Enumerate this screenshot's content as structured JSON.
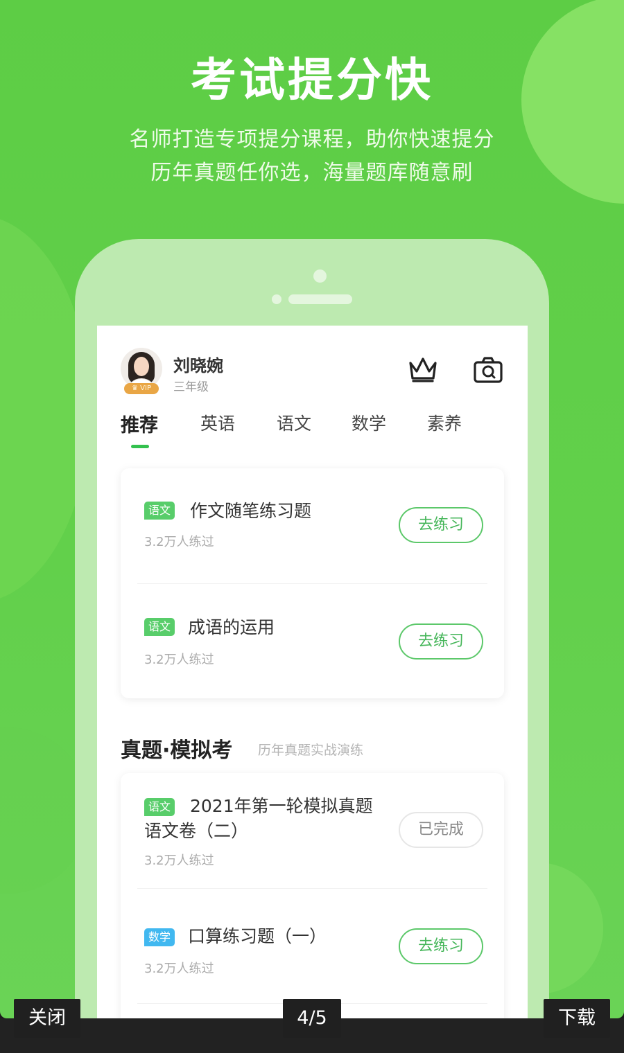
{
  "banner": {
    "headline": "考试提分快",
    "subline_1": "名师打造专项提分课程，助你快速提分",
    "subline_2": "历年真题任你选，海量题库随意刷"
  },
  "profile": {
    "name": "刘晓婉",
    "grade": "三年级",
    "vip_label": "VIP"
  },
  "header_icons": [
    "crown-icon",
    "camera-search-icon"
  ],
  "tabs": [
    {
      "label": "推荐",
      "active": true
    },
    {
      "label": "英语"
    },
    {
      "label": "语文"
    },
    {
      "label": "数学"
    },
    {
      "label": "素养"
    }
  ],
  "recommend": {
    "items": [
      {
        "tag": "语文",
        "title": "作文随笔练习题",
        "meta": "3.2万人练过",
        "action": "去练习"
      },
      {
        "tag": "语文",
        "title": "成语的运用",
        "meta": "3.2万人练过",
        "action": "去练习"
      }
    ]
  },
  "exam_section": {
    "title": "真题·模拟考",
    "subtitle": "历年真题实战演练",
    "items": [
      {
        "tag": "语文",
        "title_line1": "2021年第一轮模拟真题",
        "title_line2": "语文卷（二）",
        "meta": "3.2万人练过",
        "action": "已完成"
      },
      {
        "tag": "数学",
        "title": "口算练习题（一）",
        "meta": "3.2万人练过",
        "action": "去练习"
      }
    ]
  },
  "viewer": {
    "close": "关闭",
    "page_indicator": "4/5",
    "download": "下载"
  },
  "colors": {
    "brand_green": "#5dcd45",
    "tag_green": "#58cd6a",
    "tag_blue": "#41b8f0",
    "vip_gold": "#e9a645"
  }
}
